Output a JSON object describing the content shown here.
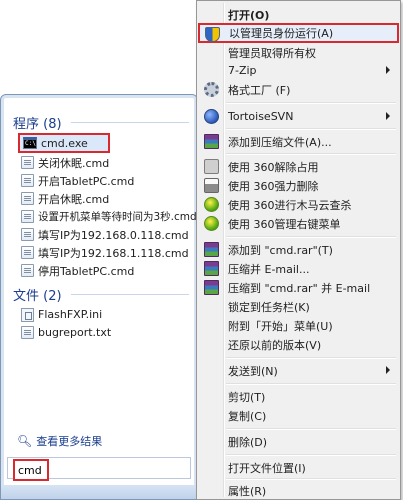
{
  "start_menu": {
    "programs_header": "程序 (8)",
    "programs": [
      {
        "label": "cmd.exe",
        "icon": "cmd-icon"
      },
      {
        "label": "关闭休眠.cmd",
        "icon": "script-file-icon"
      },
      {
        "label": "开启TabletPC.cmd",
        "icon": "script-file-icon"
      },
      {
        "label": "开启休眠.cmd",
        "icon": "script-file-icon"
      },
      {
        "label": "设置开机菜单等待时间为3秒.cmd",
        "icon": "script-file-icon"
      },
      {
        "label": "填写IP为192.168.0.118.cmd",
        "icon": "script-file-icon"
      },
      {
        "label": "填写IP为192.168.1.118.cmd",
        "icon": "script-file-icon"
      },
      {
        "label": "停用TabletPC.cmd",
        "icon": "script-file-icon"
      }
    ],
    "files_header": "文件 (2)",
    "files": [
      {
        "label": "FlashFXP.ini",
        "icon": "ini-file-icon"
      },
      {
        "label": "bugreport.txt",
        "icon": "text-file-icon"
      }
    ],
    "see_more": "查看更多结果",
    "search_value": "cmd"
  },
  "context_menu": {
    "items": [
      {
        "label": "打开(O)",
        "bold": true,
        "icon": ""
      },
      {
        "label": "以管理员身份运行(A)",
        "icon": "uac-shield-icon"
      },
      {
        "label": "管理员取得所有权",
        "icon": ""
      },
      {
        "label": "7-Zip",
        "icon": "",
        "submenu": true
      },
      {
        "label": "格式工厂 (F)",
        "icon": "format-factory-icon"
      },
      {
        "label": "TortoiseSVN",
        "icon": "tortoisesvn-icon",
        "submenu": true
      },
      {
        "label": "添加到压缩文件(A)...",
        "icon": "winrar-icon"
      },
      {
        "label": "使用 360解除占用",
        "icon": "360-icon"
      },
      {
        "label": "使用 360强力删除",
        "icon": "360-shred-icon"
      },
      {
        "label": "使用 360进行木马云查杀",
        "icon": "360-scan-icon"
      },
      {
        "label": "使用 360管理右键菜单",
        "icon": "360-scan-icon"
      },
      {
        "label": "添加到 \"cmd.rar\"(T)",
        "icon": "winrar-icon"
      },
      {
        "label": "压缩并 E-mail...",
        "icon": "winrar-icon"
      },
      {
        "label": "压缩到 \"cmd.rar\" 并 E-mail",
        "icon": "winrar-icon"
      },
      {
        "label": "锁定到任务栏(K)",
        "icon": ""
      },
      {
        "label": "附到「开始」菜单(U)",
        "icon": ""
      },
      {
        "label": "还原以前的版本(V)",
        "icon": ""
      },
      {
        "label": "发送到(N)",
        "icon": "",
        "submenu": true
      },
      {
        "label": "剪切(T)",
        "icon": ""
      },
      {
        "label": "复制(C)",
        "icon": ""
      },
      {
        "label": "删除(D)",
        "icon": ""
      },
      {
        "label": "打开文件位置(I)",
        "icon": ""
      },
      {
        "label": "属性(R)",
        "icon": ""
      }
    ]
  },
  "colors": {
    "highlight_border": "#d8292e",
    "header_text": "#1a3d8f"
  }
}
